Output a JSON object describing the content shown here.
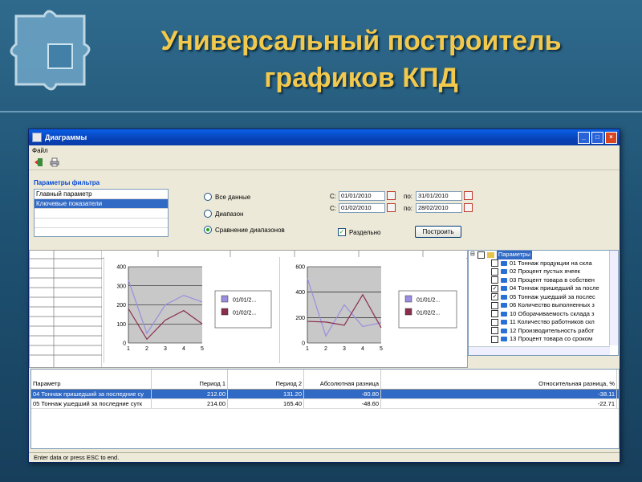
{
  "slide": {
    "title_line1": "Универсальный построитель",
    "title_line2": "графиков КПД"
  },
  "window": {
    "title": "Диаграммы",
    "menu_file": "Файл"
  },
  "filter": {
    "title": "Параметры фильтра",
    "items": [
      "Главный параметр",
      "Ключевые показатели"
    ],
    "selected_index": 1
  },
  "options": {
    "all_data": "Все данные",
    "range": "Диапазон",
    "compare": "Сравнение диапазонов",
    "selected": "compare"
  },
  "dates": {
    "from_label": "С:",
    "to_label": "по:",
    "range1_from": "01/01/2010",
    "range1_to": "31/01/2010",
    "range2_from": "01/02/2010",
    "range2_to": "28/02/2010"
  },
  "separate": {
    "label": "Раздельно",
    "checked": true
  },
  "build_button": "Построить",
  "chart_data": [
    {
      "type": "line",
      "x": [
        1,
        2,
        3,
        4,
        5
      ],
      "xlim": [
        1,
        5
      ],
      "ylim": [
        0,
        400
      ],
      "yticks": [
        0,
        100,
        200,
        300,
        400
      ],
      "series": [
        {
          "name": "01/01/2...",
          "color": "#9a8ee0",
          "values": [
            330,
            50,
            200,
            250,
            215
          ]
        },
        {
          "name": "01/02/2...",
          "color": "#8b2d4e",
          "values": [
            180,
            20,
            120,
            170,
            100
          ]
        }
      ]
    },
    {
      "type": "line",
      "x": [
        1,
        2,
        3,
        4,
        5
      ],
      "xlim": [
        1,
        5
      ],
      "ylim": [
        0,
        600
      ],
      "yticks": [
        0,
        200,
        400,
        600
      ],
      "series": [
        {
          "name": "01/01/2...",
          "color": "#9a8ee0",
          "values": [
            510,
            55,
            300,
            130,
            160
          ]
        },
        {
          "name": "01/02/2...",
          "color": "#8b2d4e",
          "values": [
            170,
            165,
            140,
            380,
            120
          ]
        }
      ]
    }
  ],
  "tree": {
    "root": "Параметры",
    "items": [
      {
        "label": "01 Тоннаж продукции на скла",
        "checked": false
      },
      {
        "label": "02 Процент пустых ячеек",
        "checked": false
      },
      {
        "label": "03 Процент товара в собствен",
        "checked": false
      },
      {
        "label": "04 Тоннаж пришедший за после",
        "checked": true
      },
      {
        "label": "05 Тоннаж ушедший за послес",
        "checked": true
      },
      {
        "label": "06 Количество выполненных з",
        "checked": false
      },
      {
        "label": "10 Оборачиваемость склада з",
        "checked": false
      },
      {
        "label": "11 Количество работников скл",
        "checked": false
      },
      {
        "label": "12 Производительность работ",
        "checked": false
      },
      {
        "label": "13 Процент товара со сроком",
        "checked": false
      }
    ]
  },
  "table": {
    "headers": [
      "Параметр",
      "Период 1",
      "Период 2",
      "Абсолютная разница",
      "Относительная разница, %"
    ],
    "rows": [
      [
        "04 Тоннаж пришедший за последние су",
        "212.00",
        "131.20",
        "-80.80",
        "-38.11"
      ],
      [
        "05 Тоннаж ушедший за последние сутк",
        "214.00",
        "165.40",
        "-48.60",
        "-22.71"
      ]
    ],
    "selected_row": 0
  },
  "status": "Enter data or press ESC to end."
}
